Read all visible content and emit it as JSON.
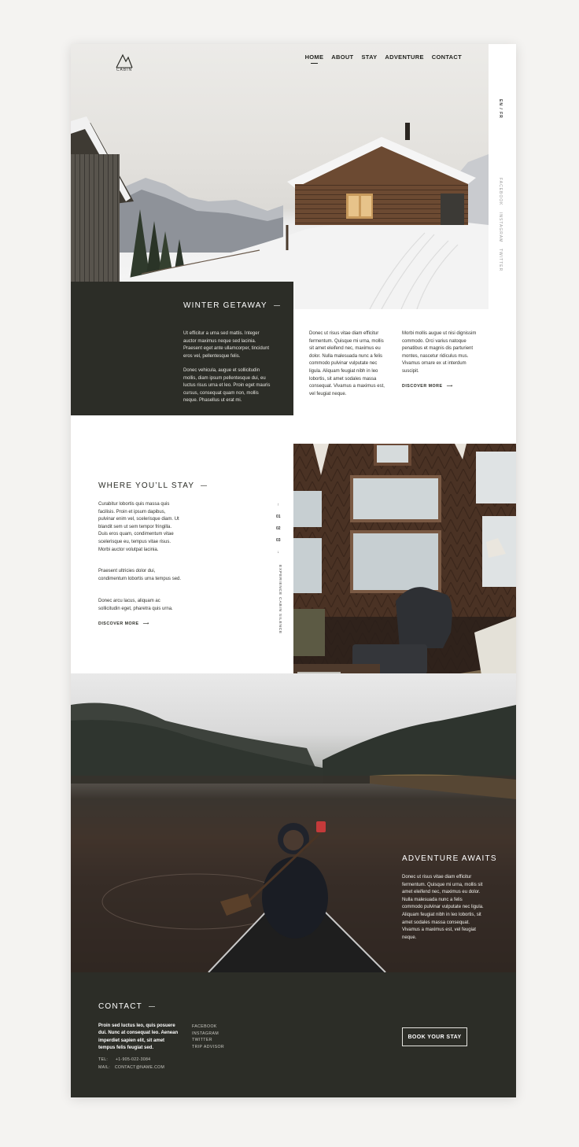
{
  "brand": {
    "logo_text": "CABIN"
  },
  "nav": {
    "items": [
      {
        "label": "HOME",
        "active": true
      },
      {
        "label": "ABOUT",
        "active": false
      },
      {
        "label": "STAY",
        "active": false
      },
      {
        "label": "ADVENTURE",
        "active": false
      },
      {
        "label": "CONTACT",
        "active": false
      }
    ]
  },
  "side": {
    "lang": "EN / FR",
    "social": [
      "FACEBOOK",
      "INSTAGRAM",
      "TWITTER"
    ]
  },
  "winter": {
    "title": "WINTER GETAWAY",
    "p1": "Ut efficitur a urna sed mattis. Integer auctor maximus neque sed lacinia. Praesent eget ante ullamcorper, tincidunt eros vel, pellentesque felis.",
    "p2": "Donec vehicula, augue et sollicitudin mollis, diam ipsum pellentesque dui, eu luctus risus urna et leo. Proin eget mauris cursus, consequat quam non, mollis neque. Phasellus ut erat mi.",
    "col2": "Donec ut risus vitae diam efficitur fermentum. Quisque mi urna, mollis sit amet eleifend nec, maximus eu dolor. Nulla malesuada nunc a felis commodo pulvinar vulputate nec ligula. Aliquam feugiat nibh in leo lobortis, sit amet sodales massa consequat. Vivamus a maximus est, vel feugiat neque.",
    "col3": "Morbi mollis augue ut nisi dignissim commodo. Orci varius natoque penatibus et magnis dis parturient montes, nascetur ridiculus mus. Vivamus ornare ex ut interdum suscipit.",
    "discover": "DISCOVER MORE"
  },
  "stay": {
    "title": "WHERE YOU’LL STAY",
    "p1": "Curabitur lobortis quis massa quis facilisis. Proin et ipsum dapibus, pulvinar enim vel, scelerisque diam. Ut blandit sem ut sem tempor fringilla. Duis eros quam, condimentum vitae scelerisque eu, tempus vitae risus. Morbi auctor volutpat lacinia.",
    "p2": "Praesent ultricies dolor dui, condimentum lobortis urna tempus sed.",
    "p3": "Donec arcu lacus, aliquam ac sollicitudin eget, pharetra quis urna.",
    "discover": "DISCOVER MORE",
    "pager": [
      "01",
      "02",
      "03"
    ],
    "vertical_label": "EXPERIENCE CABIN SILENCE"
  },
  "adventure": {
    "title": "ADVENTURE AWAITS",
    "text": "Donec ut risus vitae diam efficitur fermentum. Quisque mi urna, mollis sit amet eleifend nec, maximus eu dolor. Nulla malesuada nunc a felis commodo pulvinar vulputate nec ligula. Aliquam feugiat nibh in leo lobortis, sit amet sodales massa consequat. Vivamus a maximus est, vel feugiat neque."
  },
  "contact": {
    "title": "CONTACT",
    "text": "Proin sed luctus leo, quis posuere dui. Nunc at consequat leo. Aenean imperdiet sapien elit, sit amet tempus felis feugiat sed.",
    "links": [
      "FACEBOOK",
      "INSTAGRAM",
      "TWITTER",
      "TRIP ADVISOR"
    ],
    "tel_label": "TEL:",
    "tel": "+1-905-022-3084",
    "mail_label": "MAIL:",
    "mail": "CONTACT@NAME.COM",
    "cta": "BOOK YOUR STAY"
  },
  "colors": {
    "dark": "#2c2d27",
    "white": "#ffffff",
    "background": "#f4f3f1"
  }
}
